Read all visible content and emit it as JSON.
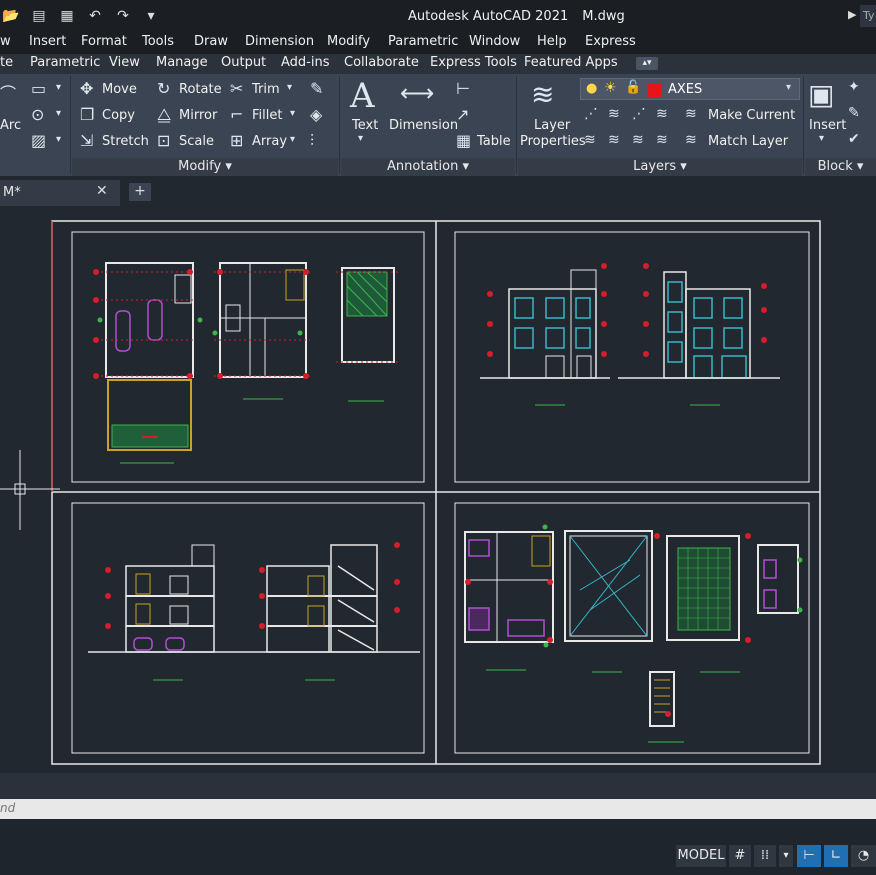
{
  "app": {
    "title": "Autodesk AutoCAD 2021",
    "file": "M.dwg",
    "search_placeholder": "Ty"
  },
  "menu": [
    "w",
    "Insert",
    "Format",
    "Tools",
    "Draw",
    "Dimension",
    "Modify",
    "Parametric",
    "Window",
    "Help",
    "Express"
  ],
  "ribbon_tabs": [
    "te",
    "Parametric",
    "View",
    "Manage",
    "Output",
    "Add-ins",
    "Collaborate",
    "Express Tools",
    "Featured Apps"
  ],
  "ribbon": {
    "draw": {
      "arc": "Arc"
    },
    "modify": {
      "move": "Move",
      "rotate": "Rotate",
      "trim": "Trim",
      "copy": "Copy",
      "mirror": "Mirror",
      "fillet": "Fillet",
      "stretch": "Stretch",
      "scale": "Scale",
      "array": "Array",
      "panel": "Modify"
    },
    "annotation": {
      "text": "Text",
      "dimension": "Dimension",
      "table": "Table",
      "panel": "Annotation"
    },
    "layers": {
      "layer_properties_1": "Layer",
      "layer_properties_2": "Properties",
      "current_layer": "AXES",
      "layer_color": "#e8141c",
      "make_current": "Make Current",
      "match_layer": "Match Layer",
      "panel": "Layers"
    },
    "block": {
      "insert": "Insert",
      "panel": "Block"
    }
  },
  "file_tab": {
    "label": "M*"
  },
  "command_line": {
    "text": "nd"
  },
  "status": {
    "model": "MODEL"
  },
  "colors": {
    "canvas": "#212830",
    "ribbon": "#3b4452",
    "accent_blue": "#1f6fb2",
    "line_white": "#e8e8e8",
    "line_red": "#d91c2a",
    "line_green": "#3db54a",
    "line_magenta": "#b14fd1",
    "line_cyan": "#37b6c7"
  }
}
